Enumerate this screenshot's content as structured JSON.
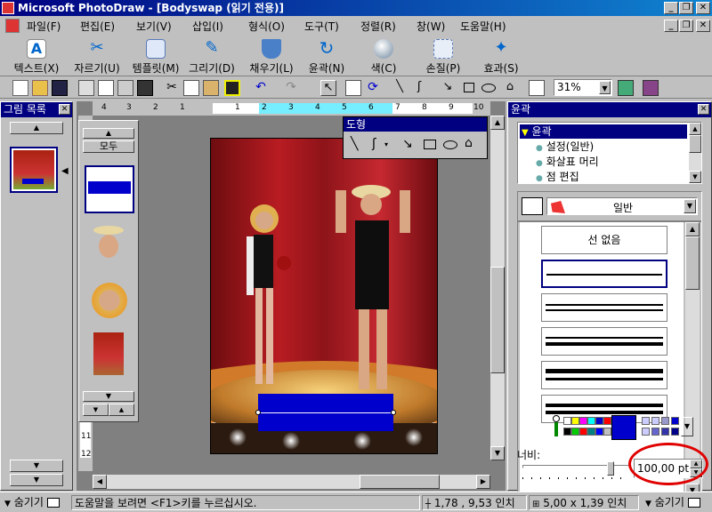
{
  "window": {
    "title": "Microsoft PhotoDraw - [Bodyswap (읽기 전용)]"
  },
  "menu": [
    "파일(F)",
    "편집(E)",
    "보기(V)",
    "삽입(I)",
    "형식(O)",
    "도구(T)",
    "정렬(R)",
    "창(W)",
    "도움말(H)"
  ],
  "big_toolbar": [
    "텍스트(X)",
    "자르기(U)",
    "템플릿(M)",
    "그리기(D)",
    "채우기(L)",
    "윤곽(N)",
    "색(C)",
    "손질(P)",
    "효과(S)"
  ],
  "zoom": "31%",
  "picture_list": {
    "title": "그림 목록"
  },
  "flyout": {
    "all_label": "모두"
  },
  "ruler": {
    "h_ticks": [
      "4",
      "3",
      "2",
      "1",
      "1",
      "2",
      "3",
      "4",
      "5",
      "6",
      "7",
      "8",
      "9",
      "10"
    ],
    "v_ticks": [
      "11",
      "12"
    ]
  },
  "shapes_palette": {
    "title": "도형"
  },
  "outline_panel": {
    "title": "윤곽",
    "tree": {
      "root": "윤곽",
      "items": [
        "설정(일반)",
        "화살표 머리",
        "점 편집"
      ]
    },
    "style_select": "일반",
    "line_styles": {
      "none_label": "선 없음"
    },
    "width_label": "너비:",
    "width_value": "100,00 pt",
    "width_level": 0.85
  },
  "colors": {
    "swatches_row1": [
      "#ffffff",
      "#ffff00",
      "#ff00ff",
      "#00ffff",
      "#0000cc",
      "#ff0000"
    ],
    "swatches_row2": [
      "#000000",
      "#00cc00",
      "#ff0000",
      "#008080",
      "#0000ff",
      "#c0c0c0"
    ],
    "selected_color": "#0000cc",
    "accent_title": "#000080",
    "highlight_circle": "#e00000"
  },
  "status": {
    "left_toggle": "숨기기",
    "help_text": "도움말을 보려면 <F1>키를 누르십시오.",
    "coords": "1,78 , 9,53 인치",
    "size": "5,00 x 1,39 인치",
    "right_toggle": "숨기기"
  }
}
